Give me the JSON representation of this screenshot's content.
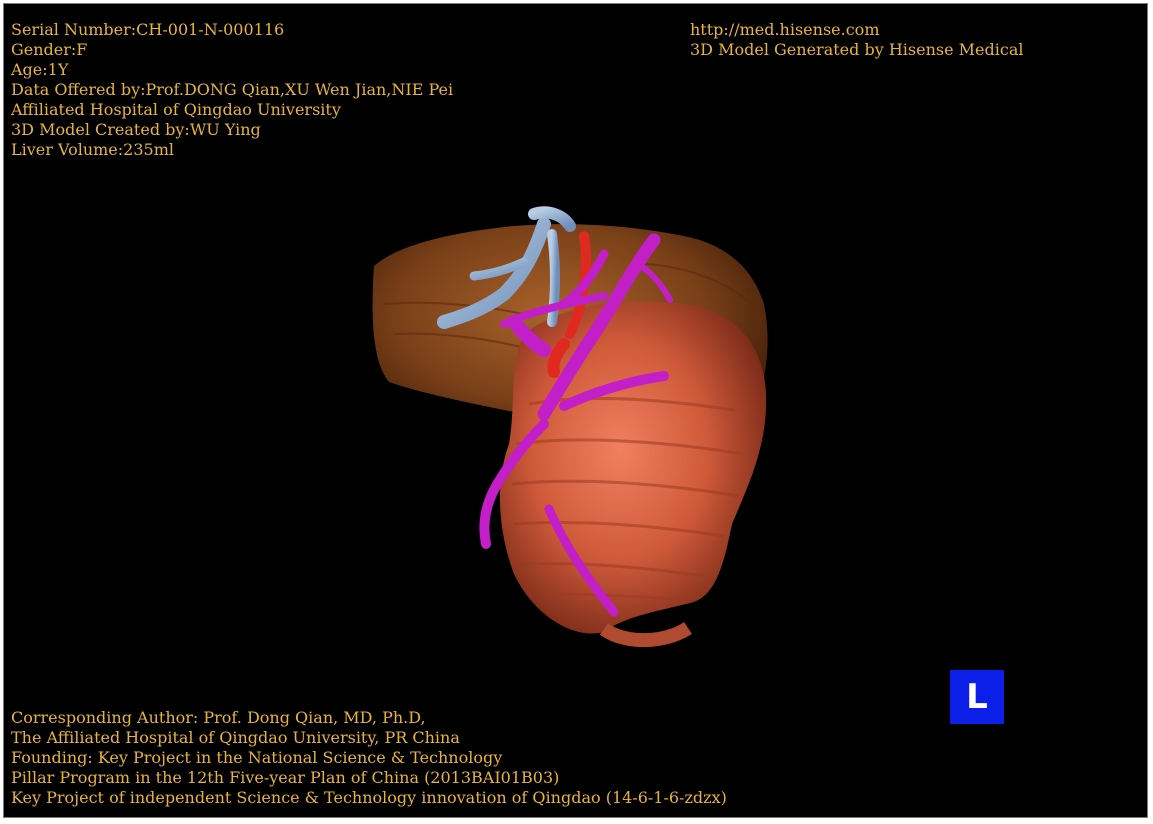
{
  "header_left": {
    "serial": "Serial Number:CH-001-N-000116",
    "gender": "Gender:F",
    "age": "Age:1Y",
    "data_offered": "Data Offered by:Prof.DONG Qian,XU Wen Jian,NIE Pei",
    "hospital": "Affiliated Hospital of Qingdao University",
    "created_by": "3D Model Created by:WU Ying",
    "liver_volume": "Liver Volume:235ml"
  },
  "header_right": {
    "url": "http://med.hisense.com",
    "generated_by": "3D Model Generated by Hisense Medical"
  },
  "footer": {
    "line1": "Corresponding Author: Prof. Dong Qian, MD, Ph.D,",
    "line2": "The Affiliated Hospital of Qingdao University, PR China",
    "line3": "Founding: Key Project in the National Science & Technology",
    "line4": "Pillar Program in the 12th Five-year Plan of China (2013BAI01B03)",
    "line5": "Key Project of independent Science & Technology innovation of Qingdao (14-6-1-6-zdzx)"
  },
  "orientation_marker": {
    "label": "L",
    "color": "#0b1fe8"
  },
  "colors": {
    "text": "#e8b43a",
    "background": "#000000",
    "liver": "#8a4a1c",
    "tumor": "#d9603f",
    "vessel_magenta": "#c21fc9",
    "vessel_blue": "#8fb0d6",
    "vessel_red": "#e02a1f"
  }
}
